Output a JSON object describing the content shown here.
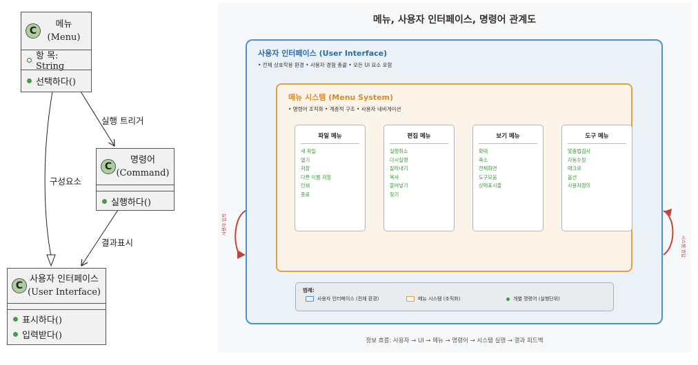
{
  "uml": {
    "menu": {
      "name": "메뉴",
      "eng": "(Menu)",
      "attr": "항 목: String",
      "op": "선택하다()"
    },
    "command": {
      "name": "명령어",
      "eng": "(Command)",
      "op": "실행하다()"
    },
    "ui": {
      "name": "사용자 인터페이스",
      "eng": "(User Interface)",
      "op1": "표시하다()",
      "op2": "입력받다()"
    },
    "icon_letter": "C",
    "labels": {
      "trigger": "실행 트리거",
      "component": "구성요소",
      "result": "결과표시"
    }
  },
  "diagram": {
    "title": "메뉴, 사용자 인터페이스, 명령어 관계도",
    "ui_box": {
      "title": "사용자 인터페이스 (User Interface)",
      "subtitle": "• 전체 상호작용 환경 • 사용자 경험 총괄 • 모든 UI 요소 포함"
    },
    "menu_box": {
      "title": "메뉴 시스템 (Menu System)",
      "subtitle": "• 명령어 조직화 • 계층적 구조 • 사용자 네비게이션"
    },
    "menus": [
      {
        "title": "파일 메뉴",
        "items": [
          "새 파일",
          "열기",
          "저장",
          "다른 이름 저장",
          "인쇄",
          "종료"
        ]
      },
      {
        "title": "편집 메뉴",
        "items": [
          "실행취소",
          "다시실행",
          "잘라내기",
          "복사",
          "붙여넣기",
          "찾기"
        ]
      },
      {
        "title": "보기 메뉴",
        "items": [
          "확대",
          "축소",
          "전체화면",
          "도구모음",
          "상태표시줄"
        ]
      },
      {
        "title": "도구 메뉴",
        "items": [
          "맞춤법검사",
          "자동수정",
          "매크로",
          "옵션",
          "사용자정의"
        ]
      }
    ],
    "legend": {
      "title": "범례:",
      "ui": "사용자 인터페이스 (전체 환경)",
      "menu": "메뉴 시스템 (조직화)",
      "command": "개별 명령어 (실행단위)"
    },
    "side_left": "사용자 입력",
    "side_right": "시스템 응답",
    "footer": "정보 흐름: 사용자 → UI → 메뉴 → 명령어 → 시스템 실행 → 결과 피드백"
  },
  "colors": {
    "ui_border": "#4a8fd0",
    "menu_border": "#e0a04a",
    "command_dot": "#3a9a3a",
    "arrow": "#c0443a"
  }
}
